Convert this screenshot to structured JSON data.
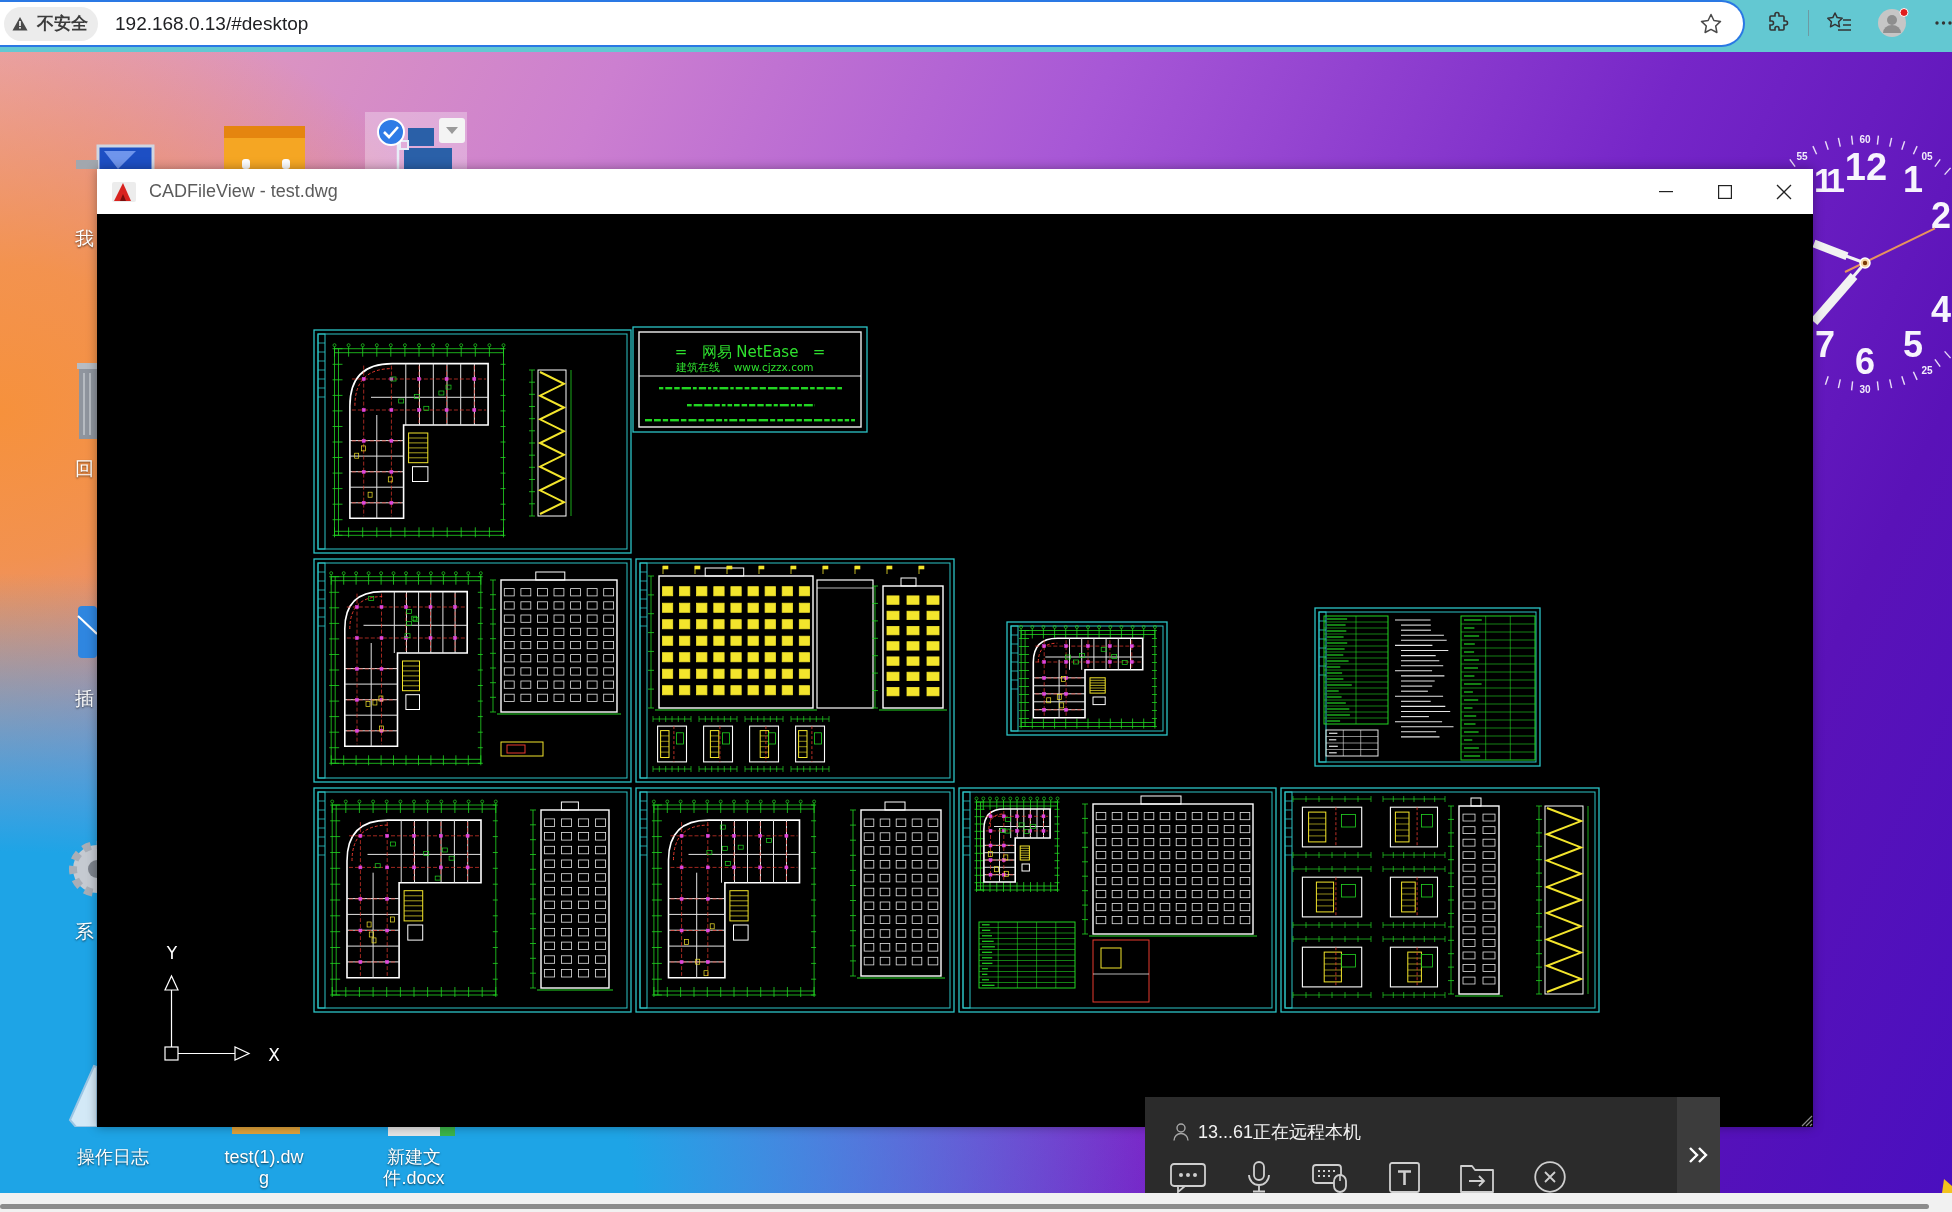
{
  "browser": {
    "security_label": "不安全",
    "url": "192.168.0.13/#desktop"
  },
  "desktop": {
    "icons": [
      {
        "label_lines": [
          "我"
        ],
        "selected": false
      },
      {
        "selected": false
      },
      {
        "selected": true
      },
      {
        "label_lines": [
          "回"
        ],
        "selected": false
      },
      {
        "label_lines": [
          "插"
        ],
        "selected": false
      },
      {
        "label_lines": [
          "系"
        ],
        "selected": false
      },
      {
        "label_lines": [
          "操作日志"
        ],
        "selected": false
      },
      {
        "label_lines": [
          "test(1).dw",
          "g"
        ],
        "selected": false
      },
      {
        "label_lines": [
          "新建文",
          "件.docx"
        ],
        "selected": false
      }
    ]
  },
  "clock": {
    "minute_labels": [
      "55",
      "60",
      "05",
      "25",
      "30"
    ],
    "hour_labels": [
      "11",
      "12",
      "1",
      "2",
      "4",
      "5",
      "6",
      "7"
    ]
  },
  "cad_window": {
    "title": "CADFileView - test.dwg",
    "title_block": {
      "heading": "=   网易 NetEase   =",
      "subtitle": "建筑在线    www.cjzzx.com"
    },
    "axis_labels": [
      "Y",
      "X"
    ]
  },
  "remote_panel": {
    "status": "13...61正在远程本机"
  }
}
